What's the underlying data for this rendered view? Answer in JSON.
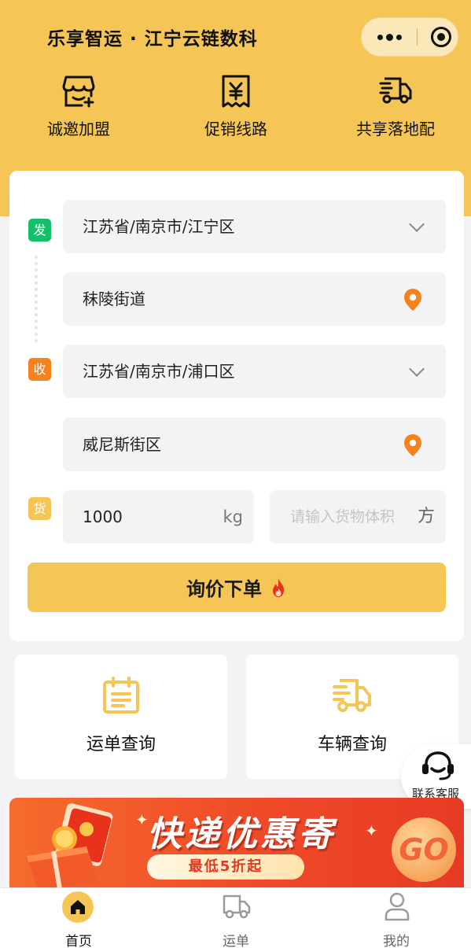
{
  "app": {
    "title": "乐享智运 · 江宁云链数科"
  },
  "capsule": {
    "more_icon": "more-icon",
    "close_icon": "record-icon"
  },
  "quick_actions": [
    {
      "label": "诚邀加盟",
      "icon": "storefront-plus-icon"
    },
    {
      "label": "促销线路",
      "icon": "receipt-yuan-icon"
    },
    {
      "label": "共享落地配",
      "icon": "delivery-truck-icon"
    }
  ],
  "form": {
    "from_tag": "发",
    "to_tag": "收",
    "cargo_tag": "货",
    "from_region": "江苏省/南京市/江宁区",
    "from_address": "秣陵街道",
    "to_region": "江苏省/南京市/浦口区",
    "to_address": "威尼斯街区",
    "weight_value": "1000",
    "weight_unit": "kg",
    "volume_placeholder": "请输入货物体积",
    "volume_unit": "方",
    "submit_label": "询价下单"
  },
  "services": [
    {
      "label": "运单查询",
      "icon": "clipboard-icon"
    },
    {
      "label": "车辆查询",
      "icon": "truck-icon"
    }
  ],
  "customer_service": {
    "label": "联系客服",
    "icon": "headset-icon"
  },
  "banner": {
    "title": "快递优惠寄",
    "subtitle": "最低5折起",
    "go": "GO"
  },
  "tabbar": [
    {
      "label": "首页",
      "icon": "home-icon",
      "active": true
    },
    {
      "label": "运单",
      "icon": "truck-icon",
      "active": false
    },
    {
      "label": "我的",
      "icon": "user-icon",
      "active": false
    }
  ],
  "colors": {
    "accent": "#f5c655",
    "from_tag": "#12c06a",
    "to_tag": "#f5821f",
    "cargo_tag": "#f5c655",
    "pin": "#f5821f"
  }
}
